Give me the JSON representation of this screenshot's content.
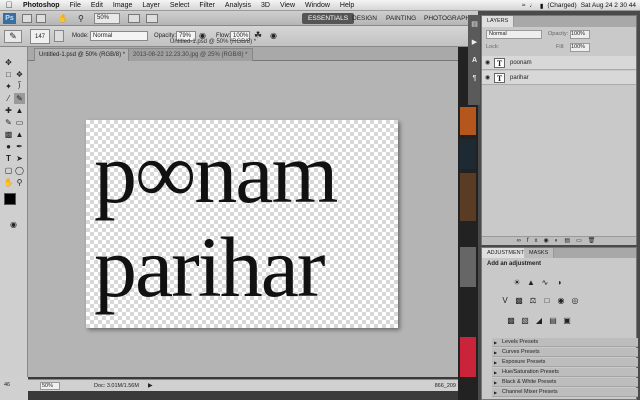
{
  "menubar": {
    "app_name": "Photoshop",
    "items": [
      "File",
      "Edit",
      "Image",
      "Layer",
      "Select",
      "Filter",
      "Analysis",
      "3D",
      "View",
      "Window",
      "Help"
    ],
    "battery": "(Charged)",
    "clock": "Sat Aug 24  2 30 44"
  },
  "appbar": {
    "logo": "Ps",
    "zoom": "50%",
    "workspaces": [
      "ESSENTIALS",
      "DESIGN",
      "PAINTING",
      "PHOTOGRAPH"
    ]
  },
  "options": {
    "brush_size": "147",
    "mode_label": "Mode:",
    "mode_value": "Normal",
    "opacity_label": "Opacity:",
    "opacity_value": "79%",
    "flow_label": "Flow:",
    "flow_value": "100%"
  },
  "tabs": [
    {
      "label": "Untitled-1.psd @ 50% (RGB/8) *"
    },
    {
      "label": "2013-08-22 12.23.30.jpg @ 25% (RGB/8) *"
    }
  ],
  "window_title": "Untitled-1.psd @ 50% (RGB/8) *",
  "canvas": {
    "line1": "p∞nam",
    "line2": "parihar"
  },
  "statusbar": {
    "zoom": "50%",
    "doc": "Doc: 3.01M/1.56M",
    "left_code": "46",
    "right_code": "866_209"
  },
  "layers_panel": {
    "tab": "LAYERS",
    "blend_mode": "Normal",
    "opacity_label": "Opacity:",
    "opacity_value": "100%",
    "lock_label": "Lock:",
    "fill_label": "Fill:",
    "fill_value": "100%",
    "layers": [
      {
        "name": "poonam",
        "kind": "T"
      },
      {
        "name": "parihar",
        "kind": "T"
      }
    ]
  },
  "adjustments_panel": {
    "tabs": [
      "ADJUSTMENTS",
      "MASKS"
    ],
    "heading": "Add an adjustment",
    "presets": [
      "Levels Presets",
      "Curves Presets",
      "Exposure Presets",
      "Hue/Saturation Presets",
      "Black & White Presets",
      "Channel Mixer Presets"
    ]
  }
}
